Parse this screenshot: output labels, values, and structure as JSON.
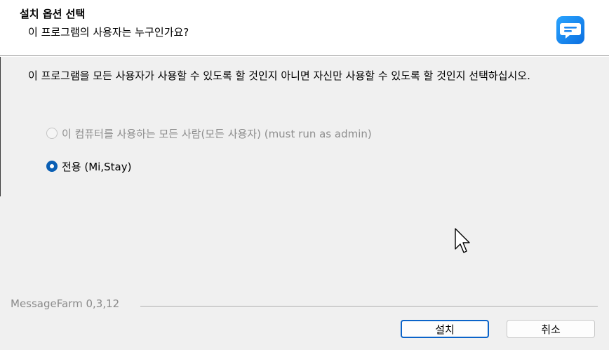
{
  "header": {
    "title": "설치 옵션 선택",
    "subtitle": "이 프로그램의 사용자는 누구인가요?",
    "icon": "chat-bubble-icon",
    "icon_color": "#1e90ff"
  },
  "description": "이 프로그램을 모든 사용자가 사용할 수 있도록 할 것인지 아니면 자신만 사용할 수 있도록 할 것인지 선택하십시오.",
  "options": [
    {
      "label": "이 컴퓨터를 사용하는 모든 사람(모든 사용자) (must run as admin)",
      "checked": false,
      "disabled": true
    },
    {
      "label": "전용 (Mi,Stay)",
      "checked": true,
      "disabled": false
    }
  ],
  "footer": {
    "brand": "MessageFarm 0,3,12",
    "install_label": "설치",
    "cancel_label": "취소"
  },
  "colors": {
    "accent": "#0a63c9",
    "background": "#f0f0f0"
  }
}
